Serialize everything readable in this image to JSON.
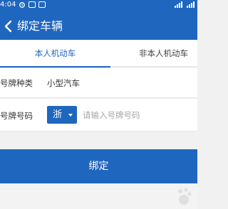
{
  "status_bar": {
    "time": "4:04"
  },
  "header": {
    "title": "绑定车辆",
    "back_icon": "chevron-left-icon"
  },
  "tabs": [
    {
      "label": "本人机动车",
      "active": true
    },
    {
      "label": "非本人机动车",
      "active": false
    }
  ],
  "form": {
    "plate_type": {
      "label": "号牌种类",
      "value": "小型汽车"
    },
    "plate_number": {
      "label": "号牌号码",
      "province": "浙",
      "placeholder": "请输入号牌号码"
    }
  },
  "submit": {
    "label": "绑定"
  },
  "colors": {
    "primary": "#1f66bf",
    "background": "#f1f1f1"
  }
}
